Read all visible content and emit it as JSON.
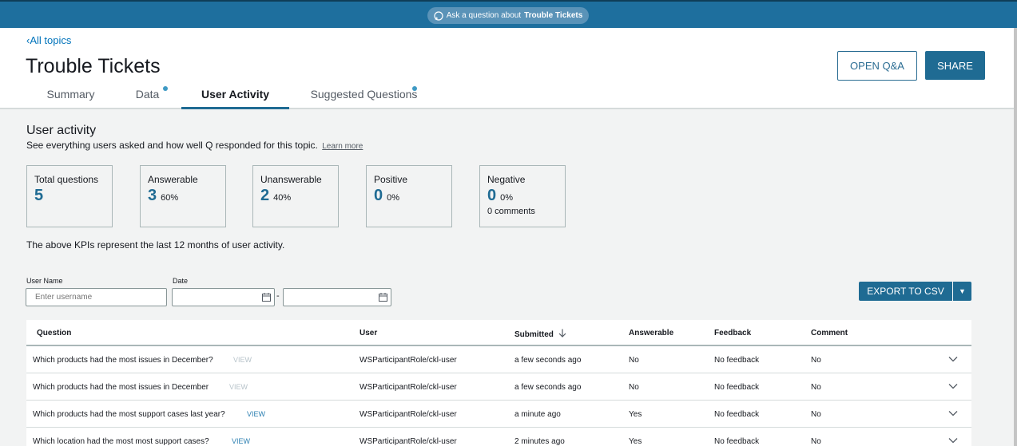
{
  "topbar": {
    "ask_prefix": "Ask a question about",
    "ask_topic": "Trouble Tickets",
    "icon": "question-bubble-icon",
    "colors": {
      "bar": "#1e6f9e",
      "pill": "#5a93b8"
    }
  },
  "header": {
    "back_label": "All topics",
    "title": "Trouble Tickets",
    "open_qa_label": "OPEN Q&A",
    "share_label": "SHARE",
    "tabs": [
      {
        "label": "Summary",
        "active": false,
        "dot": false
      },
      {
        "label": "Data",
        "active": false,
        "dot": true
      },
      {
        "label": "User Activity",
        "active": true,
        "dot": false
      },
      {
        "label": "Suggested Questions",
        "active": false,
        "dot": true
      }
    ]
  },
  "activity": {
    "title": "User activity",
    "description": "See everything users asked and how well Q responded for this topic.",
    "learn_more": "Learn more",
    "note": "The above KPIs represent the last 12 months of user activity."
  },
  "kpis": [
    {
      "label": "Total questions",
      "value": "5",
      "percent": "",
      "extra": ""
    },
    {
      "label": "Answerable",
      "value": "3",
      "percent": "60%",
      "extra": ""
    },
    {
      "label": "Unanswerable",
      "value": "2",
      "percent": "40%",
      "extra": ""
    },
    {
      "label": "Positive",
      "value": "0",
      "percent": "0%",
      "extra": ""
    },
    {
      "label": "Negative",
      "value": "0",
      "percent": "0%",
      "extra": "0 comments"
    }
  ],
  "filters": {
    "user_label": "User Name",
    "user_placeholder": "Enter username",
    "date_label": "Date",
    "date_separator": "-",
    "date_icon": "calendar-icon"
  },
  "export": {
    "label": "EXPORT TO CSV",
    "icon": "caret-down-icon"
  },
  "table": {
    "columns": [
      "Question",
      "User",
      "Submitted",
      "Answerable",
      "Feedback",
      "Comment"
    ],
    "sort_icon": "arrow-down-icon",
    "rows": [
      {
        "question": "Which products had the most issues in December?",
        "view": "VIEW",
        "view_enabled": false,
        "user": "WSParticipantRole/ckl-user",
        "submitted": "a few seconds ago",
        "answerable": "No",
        "feedback": "No feedback",
        "comment": "No"
      },
      {
        "question": "Which products had the most issues in December",
        "view": "VIEW",
        "view_enabled": false,
        "user": "WSParticipantRole/ckl-user",
        "submitted": "a few seconds ago",
        "answerable": "No",
        "feedback": "No feedback",
        "comment": "No"
      },
      {
        "question": "Which products had the most support cases last year?",
        "view": "VIEW",
        "view_enabled": true,
        "user": "WSParticipantRole/ckl-user",
        "submitted": "a minute ago",
        "answerable": "Yes",
        "feedback": "No feedback",
        "comment": "No"
      },
      {
        "question": "Which location had the most most support cases?",
        "view": "VIEW",
        "view_enabled": true,
        "user": "WSParticipantRole/ckl-user",
        "submitted": "2 minutes ago",
        "answerable": "Yes",
        "feedback": "No feedback",
        "comment": "No"
      }
    ]
  }
}
